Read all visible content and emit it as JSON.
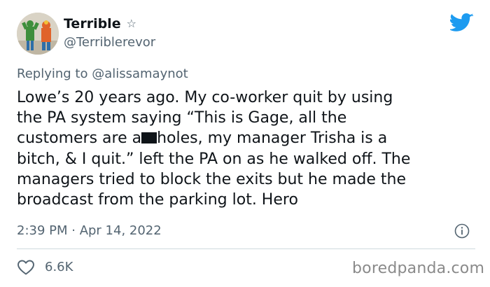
{
  "user": {
    "display_name": "Terrible",
    "handle": "@Terriblerevor"
  },
  "reply": {
    "prefix": "Replying to ",
    "mention": "@alissamaynot"
  },
  "tweet": {
    "lines": [
      "Lowe’s 20 years ago. My co-worker quit by using",
      "the PA system saying “This is Gage, all the",
      "customers are a",
      "holes, my manager Trisha is a",
      "bitch, & I quit.” left the PA on as he walked off. The",
      "managers tried to block the exits but he made the",
      "broadcast from the parking lot. Hero"
    ]
  },
  "meta": {
    "timestamp": "2:39 PM · Apr 14, 2022",
    "likes": "6.6K"
  },
  "watermark": "boredpanda.com",
  "colors": {
    "brand_blue": "#1d9bf0",
    "text_primary": "#0f1419",
    "text_secondary": "#536471",
    "divider": "#cfd9de"
  },
  "icons": [
    "star-icon",
    "twitter-bird-icon",
    "info-icon",
    "heart-icon"
  ]
}
